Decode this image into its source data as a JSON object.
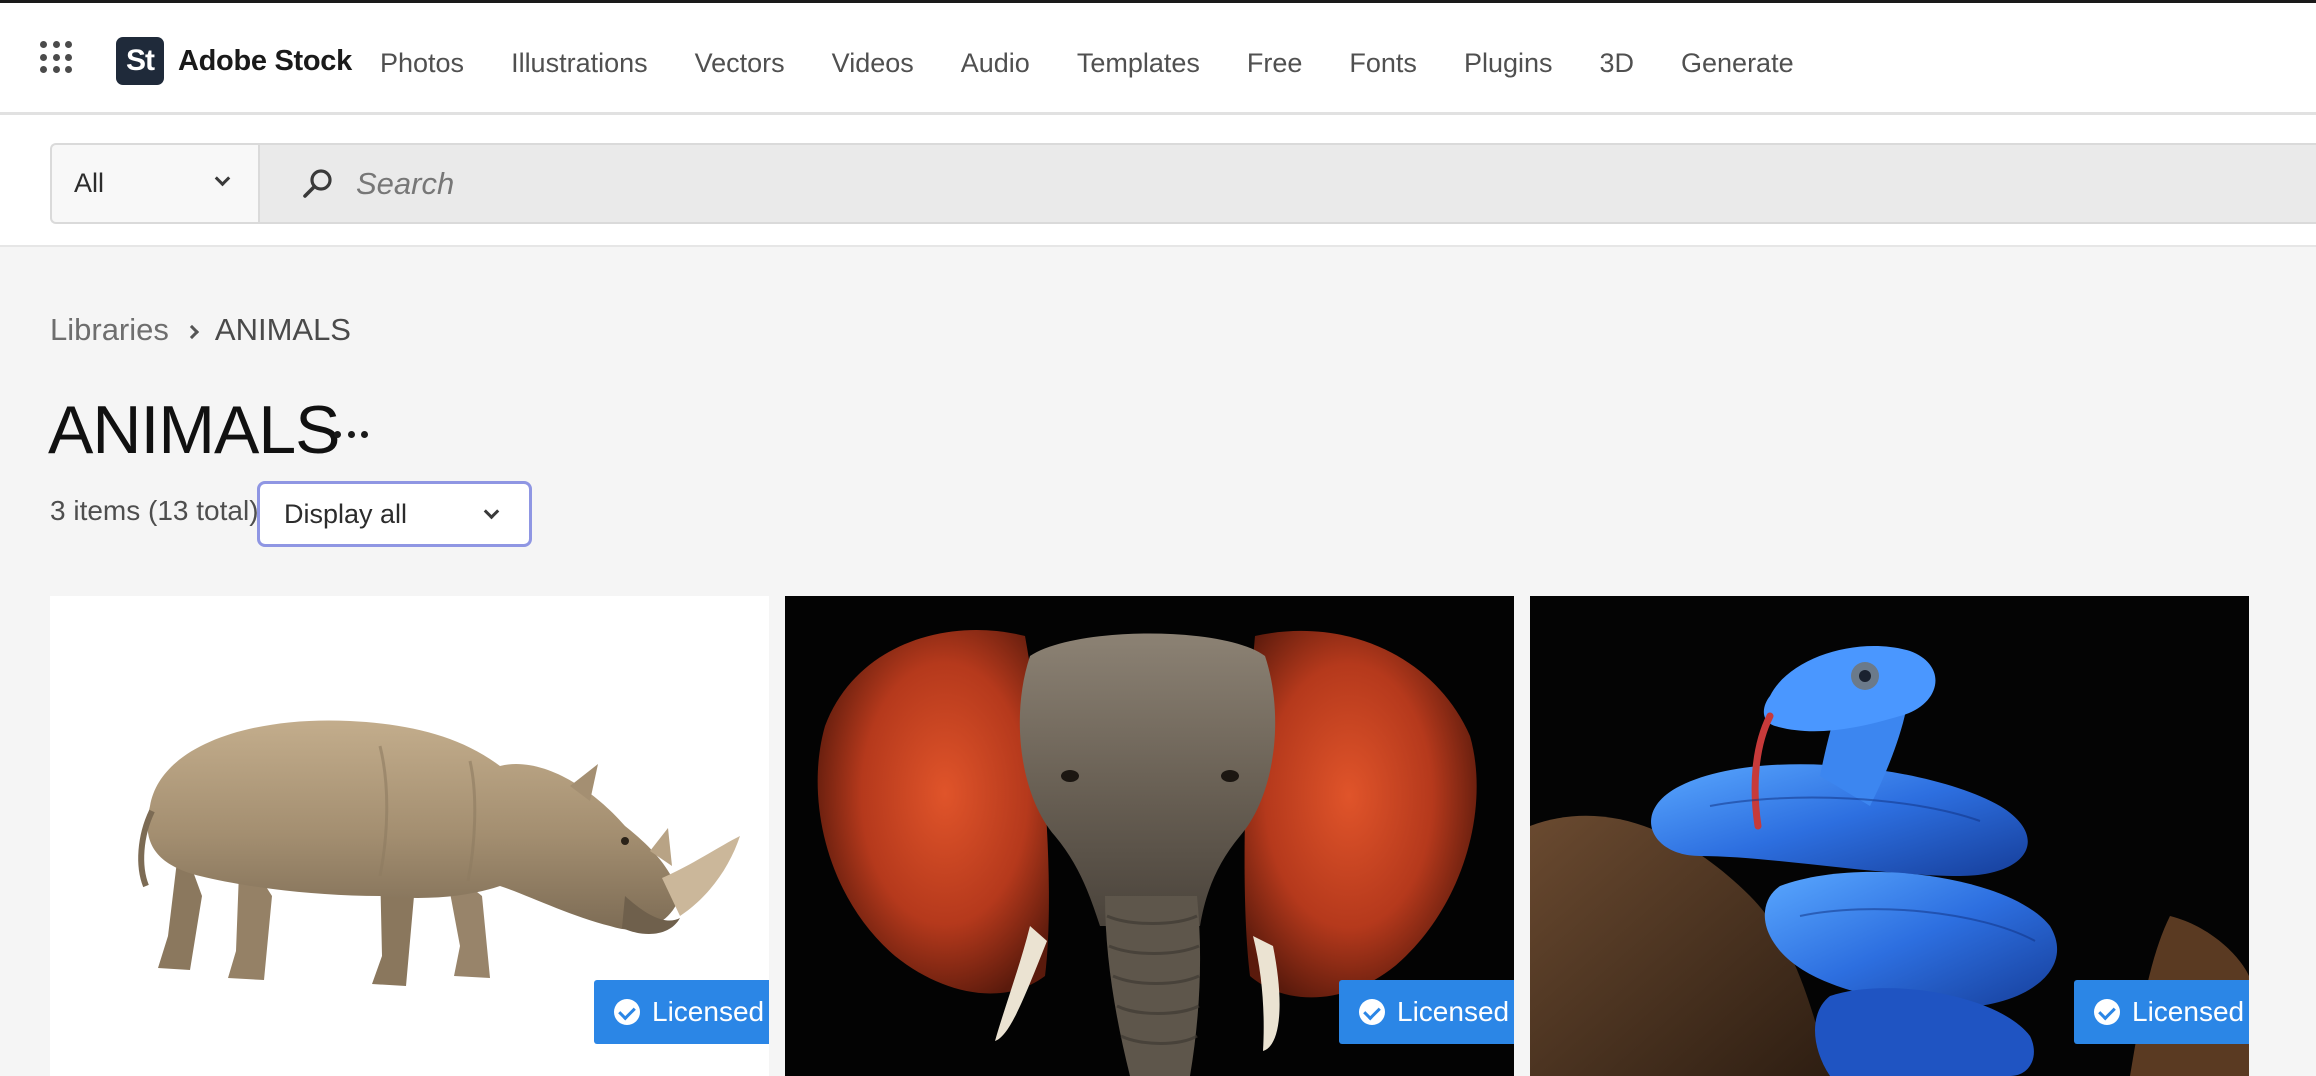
{
  "brand": {
    "logo_text": "St",
    "name": "Adobe Stock"
  },
  "nav": {
    "items": [
      "Photos",
      "Illustrations",
      "Vectors",
      "Videos",
      "Audio",
      "Templates",
      "Free",
      "Fonts",
      "Plugins",
      "3D",
      "Generate"
    ]
  },
  "search": {
    "scope_value": "All",
    "placeholder": "Search"
  },
  "breadcrumb": {
    "parent": "Libraries",
    "current": "ANIMALS"
  },
  "library": {
    "title": "ANIMALS",
    "count_text": "3 items (13 total)",
    "filter_value": "Display all"
  },
  "assets": [
    {
      "subject": "rhinoceros",
      "badge": "Licensed"
    },
    {
      "subject": "elephant",
      "badge": "Licensed"
    },
    {
      "subject": "blue viper snake",
      "badge": "Licensed"
    }
  ],
  "colors": {
    "accent": "#2b86e6",
    "focus_ring": "#8f96e3",
    "page_bg": "#f5f5f5"
  },
  "icons": {
    "app_switcher": "grid-icon",
    "search": "search-icon",
    "dropdown": "chevron-down-icon",
    "breadcrumb_separator": "chevron-right-icon",
    "more": "more-icon",
    "licensed": "check-circle-icon"
  }
}
